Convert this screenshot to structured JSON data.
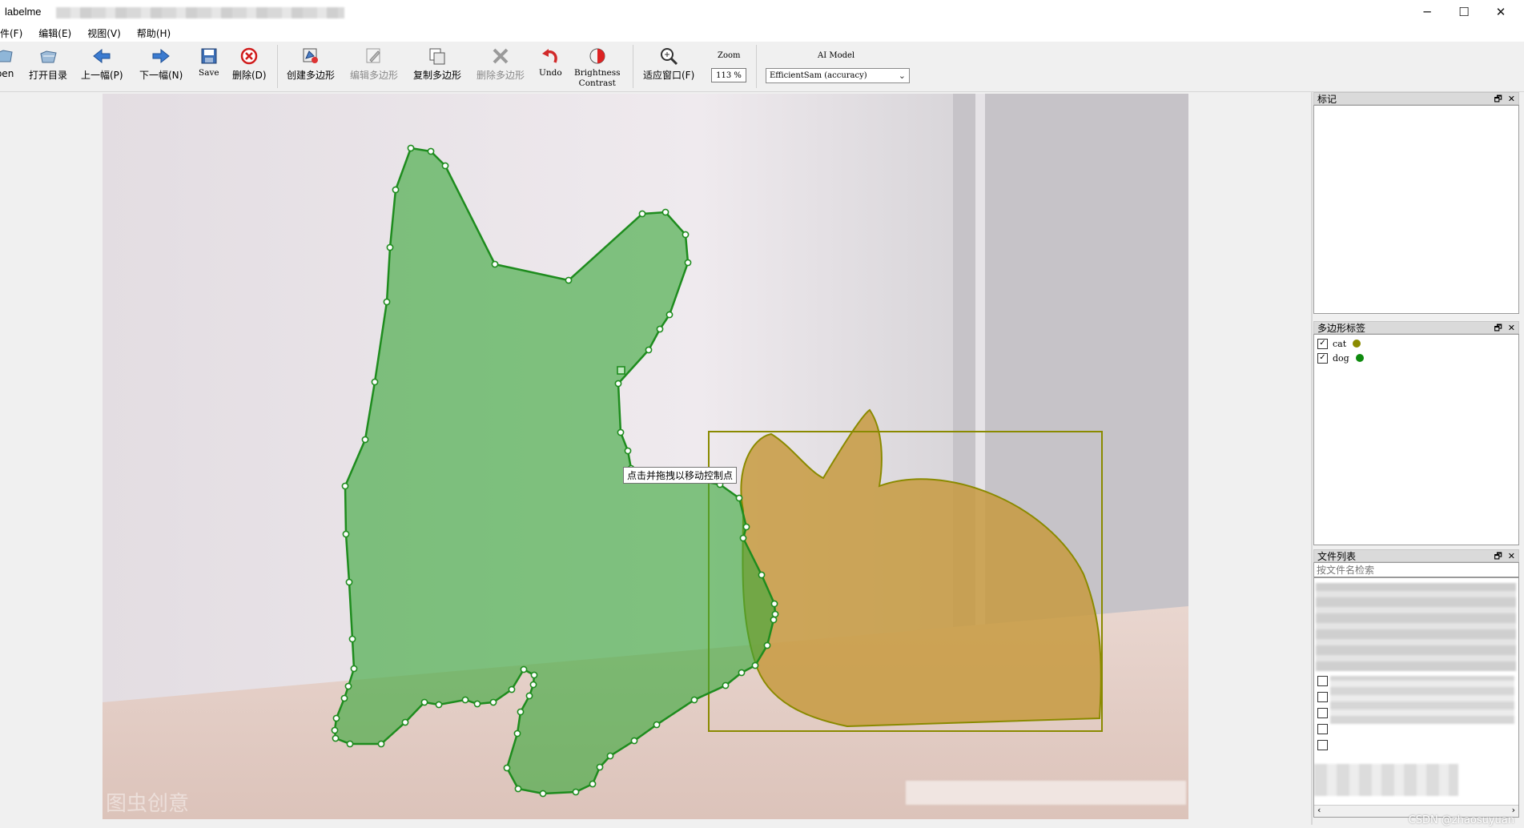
{
  "window": {
    "title": "labelme",
    "minimize": "─",
    "maximize": "☐",
    "close": "✕"
  },
  "menu": [
    "件(F)",
    "编辑(E)",
    "视图(V)",
    "帮助(H)"
  ],
  "toolbar": {
    "open": "pen",
    "open_dir": "打开目录",
    "prev": "上一幅(P)",
    "next": "下一幅(N)",
    "save": "Save",
    "delete_file": "删除(D)",
    "create_polygon": "创建多边形",
    "edit_polygon": "编辑多边形",
    "copy_polygon": "复制多边形",
    "delete_polygon": "删除多边形",
    "undo": "Undo",
    "brightness": "Brightness",
    "contrast": "Contrast",
    "fit_window": "适应窗口(F)",
    "zoom_label": "Zoom",
    "zoom_value": "113 %",
    "ai_model_label": "AI Model",
    "ai_model_value": "EfficientSam (accuracy)"
  },
  "canvas": {
    "tooltip": "点击并拖拽以移动控制点",
    "colors": {
      "dog": "#1e8c1e",
      "cat": "#8a8a00"
    }
  },
  "docks": {
    "flags_title": "标记",
    "polygon_labels_title": "多边形标签",
    "polygon_labels": [
      {
        "label": "cat",
        "color": "#8b8b00",
        "checked": true
      },
      {
        "label": "dog",
        "color": "#0e8a0e",
        "checked": true
      }
    ],
    "file_list_title": "文件列表",
    "file_search_placeholder": "按文件名检索"
  },
  "watermark": "CSDN @zhaosuyuan"
}
